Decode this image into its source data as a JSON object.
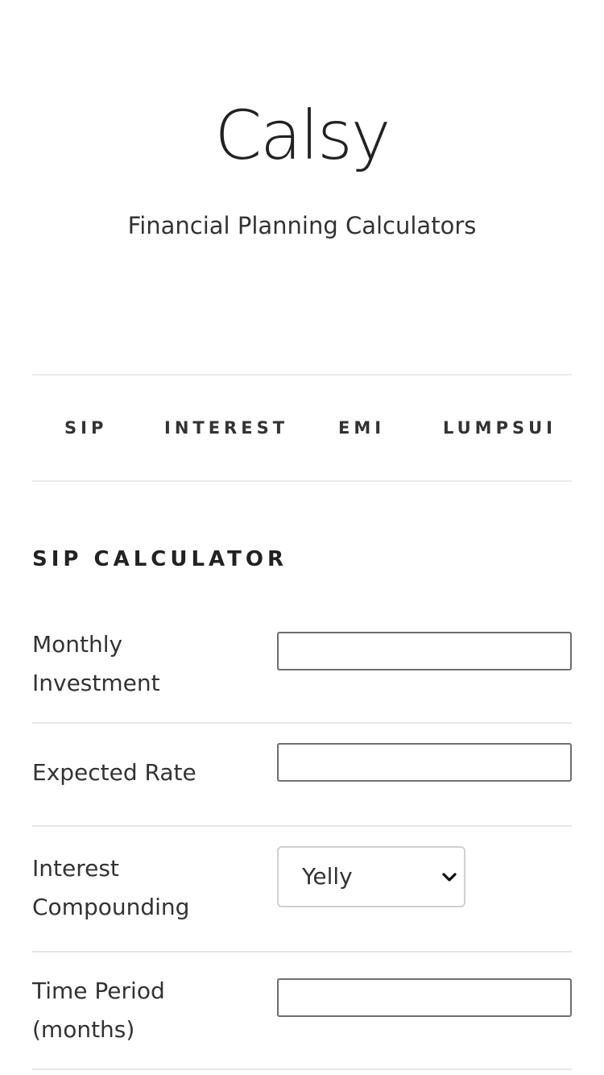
{
  "header": {
    "title": "Calsy",
    "subtitle": "Financial Planning Calculators"
  },
  "tabs": [
    {
      "label": "SIP"
    },
    {
      "label": "INTEREST"
    },
    {
      "label": "EMI"
    },
    {
      "label": "LUMPSUI"
    }
  ],
  "calculator": {
    "title": "SIP CALCULATOR",
    "fields": [
      {
        "label": "Monthly Investment",
        "value": ""
      },
      {
        "label": "Expected Rate",
        "value": ""
      },
      {
        "label": "Interest Compounding",
        "selected": "Yelly"
      },
      {
        "label": "Time Period (months)",
        "value": ""
      }
    ]
  },
  "icons": {
    "select_arrow": "chevron-down-icon"
  },
  "colors": {
    "text": "#222222",
    "divider": "#e6e6e6",
    "input_border": "#6e6e6e"
  }
}
